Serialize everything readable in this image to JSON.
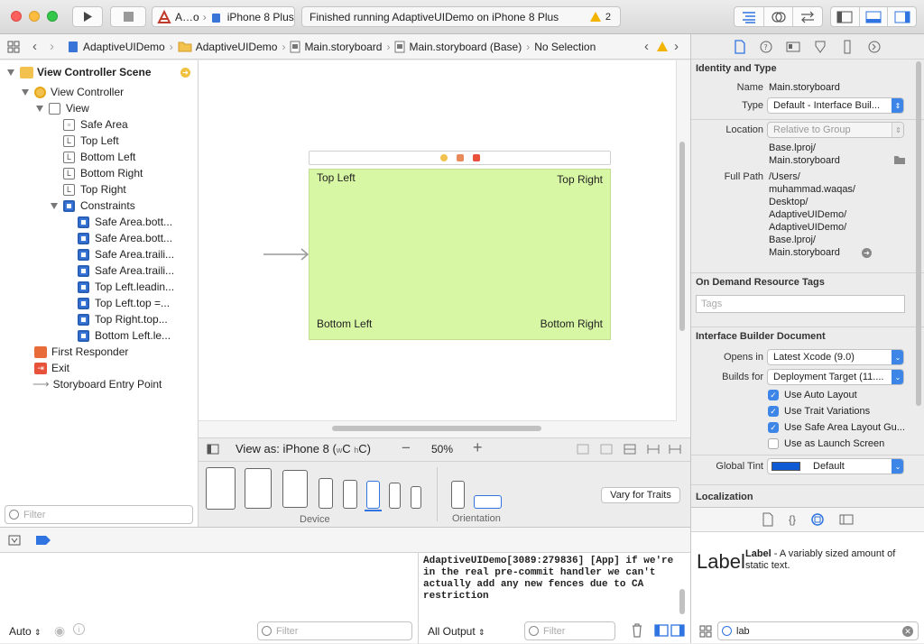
{
  "toolbar": {
    "scheme": "A…o",
    "device": "iPhone 8 Plus",
    "status": "Finished running AdaptiveUIDemo on iPhone 8 Plus",
    "warnings": "2"
  },
  "jumpbar": {
    "crumbs": [
      "AdaptiveUIDemo",
      "AdaptiveUIDemo",
      "Main.storyboard",
      "Main.storyboard (Base)",
      "No Selection"
    ]
  },
  "navigator": {
    "scene": "View Controller Scene",
    "items": [
      "View Controller",
      "View",
      "Safe Area",
      "Top Left",
      "Bottom Left",
      "Bottom Right",
      "Top Right",
      "Constraints",
      "Safe Area.bott...",
      "Safe Area.bott...",
      "Safe Area.traili...",
      "Safe Area.traili...",
      "Top Left.leadin...",
      "Top Left.top =...",
      "Top Right.top...",
      "Bottom Left.le...",
      "First Responder",
      "Exit",
      "Storyboard Entry Point"
    ],
    "filter_placeholder": "Filter"
  },
  "canvas": {
    "labels": {
      "top_left": "Top Left",
      "top_right": "Top Right",
      "bottom_left": "Bottom Left",
      "bottom_right": "Bottom Right"
    },
    "view_as_prefix": "View as: iPhone 8 (",
    "view_as_w": "w",
    "view_as_c1": "C ",
    "view_as_h": "h",
    "view_as_c2": "C)",
    "zoom": "50%",
    "device_label": "Device",
    "orientation_label": "Orientation",
    "vary_button": "Vary for Traits"
  },
  "inspector": {
    "identity_header": "Identity and Type",
    "name_label": "Name",
    "name_value": "Main.storyboard",
    "type_label": "Type",
    "type_value": "Default - Interface Buil...",
    "location_label": "Location",
    "location_value": "Relative to Group",
    "location_path": [
      "Base.lproj/",
      "Main.storyboard"
    ],
    "fullpath_label": "Full Path",
    "fullpath_lines": [
      "/Users/",
      "muhammad.waqas/",
      "Desktop/",
      "AdaptiveUIDemo/",
      "AdaptiveUIDemo/",
      "Base.lproj/",
      "Main.storyboard"
    ],
    "ondemand_header": "On Demand Resource Tags",
    "tags_placeholder": "Tags",
    "ibdoc_header": "Interface Builder Document",
    "opens_label": "Opens in",
    "opens_value": "Latest Xcode (9.0)",
    "builds_label": "Builds for",
    "builds_value": "Deployment Target (11....",
    "checks": [
      "Use Auto Layout",
      "Use Trait Variations",
      "Use Safe Area Layout Gu...",
      "Use as Launch Screen"
    ],
    "tint_label": "Global Tint",
    "tint_value": "Default",
    "localization_header": "Localization"
  },
  "library": {
    "item_big": "Label",
    "item_title": "Label",
    "item_desc": " - A variably sized amount of static text.",
    "search_value": "lab"
  },
  "debug": {
    "auto": "Auto",
    "filter_placeholder": "Filter",
    "output_menu": "All Output",
    "output_filter": "Filter",
    "console_text": "AdaptiveUIDemo[3089:279836] [App] if we're in the real pre-commit handler we can't actually add any new fences due to CA restriction"
  },
  "colors": {
    "accent": "#3d86e8",
    "canvas_view": "#d8f7a4",
    "warning": "#f2b400"
  }
}
